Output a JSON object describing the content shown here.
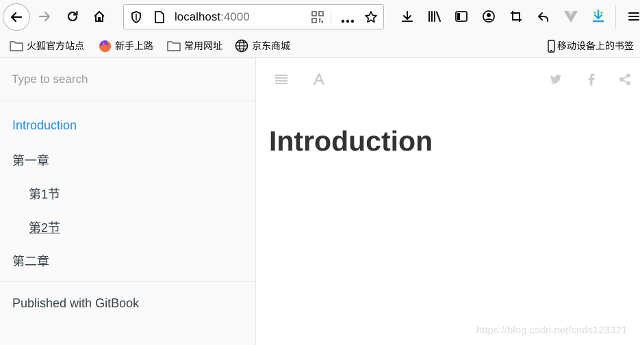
{
  "browser": {
    "url_host": "localhost",
    "url_port": ":4000",
    "icons": [
      "back-icon",
      "forward-icon",
      "reload-icon",
      "home-icon",
      "shield-icon",
      "page-icon",
      "qr-code-icon",
      "more-icon",
      "star-icon",
      "download-icon",
      "library-icon",
      "sidebar-icon",
      "account-icon",
      "crop-icon",
      "undo-icon",
      "vue-devtools-icon",
      "extension-download-icon",
      "menu-icon"
    ]
  },
  "bookmarks": {
    "items": [
      {
        "label": "火狐官方站点",
        "icon": "folder-icon"
      },
      {
        "label": "新手上路",
        "icon": "firefox-icon"
      },
      {
        "label": "常用网址",
        "icon": "folder-icon"
      },
      {
        "label": "京东商城",
        "icon": "globe-icon"
      }
    ],
    "mobile_label": "移动设备上的书签"
  },
  "sidebar": {
    "search_placeholder": "Type to search",
    "items": [
      {
        "label": "Introduction"
      },
      {
        "label": "第一章"
      },
      {
        "label": "第1节"
      },
      {
        "label": "第2节"
      },
      {
        "label": "第二章"
      }
    ],
    "published": "Published with GitBook"
  },
  "header_icons": [
    "toc-icon",
    "font-icon",
    "twitter-icon",
    "facebook-icon",
    "share-icon"
  ],
  "page": {
    "title": "Introduction"
  },
  "watermark": "https://blog.csdn.net/cnds123321",
  "colors": {
    "accent": "#1e88e5",
    "text": "#364149",
    "icon_gray": "#cccccc"
  }
}
